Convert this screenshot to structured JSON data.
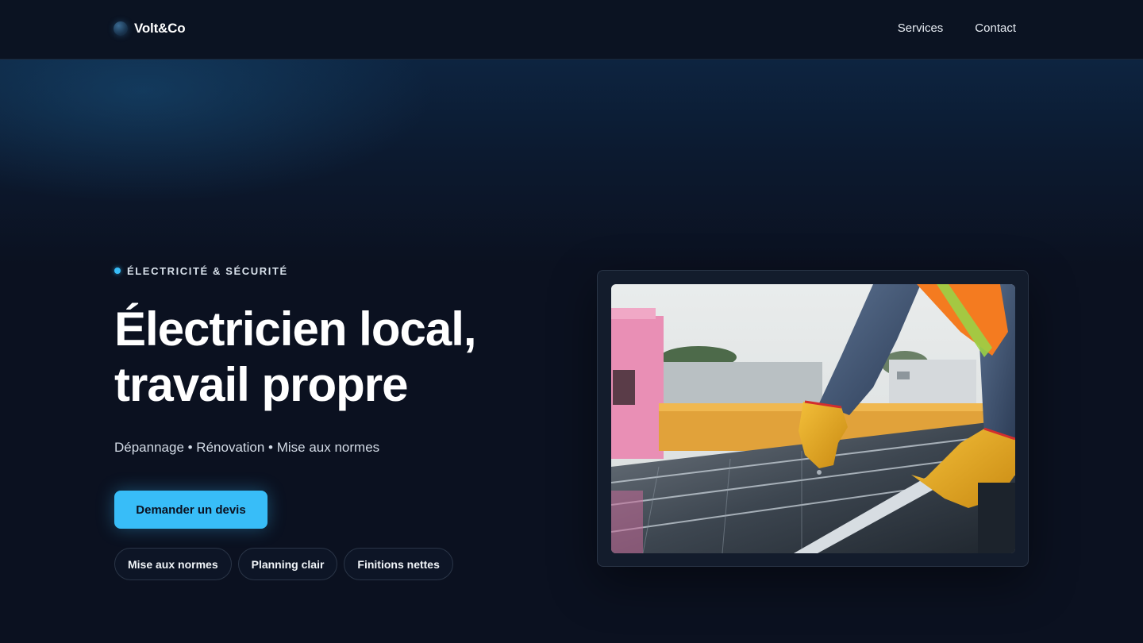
{
  "header": {
    "brand_name": "Volt&Co",
    "nav": [
      {
        "label": "Services"
      },
      {
        "label": "Contact"
      }
    ]
  },
  "hero": {
    "eyebrow": "ÉLECTRICITÉ & SÉCURITÉ",
    "title_line1": "Électricien local,",
    "title_line2": "travail propre",
    "subtitle": "Dépannage • Rénovation • Mise aux normes",
    "cta_label": "Demander un devis",
    "chips": [
      {
        "label": "Mise aux normes"
      },
      {
        "label": "Planning clair"
      },
      {
        "label": "Finitions nettes"
      }
    ]
  },
  "image": {
    "subject": "electrician-installing-solar-panels"
  },
  "colors": {
    "background": "#0b1120",
    "accent": "#38bdf8",
    "text": "#f1f5f9"
  }
}
